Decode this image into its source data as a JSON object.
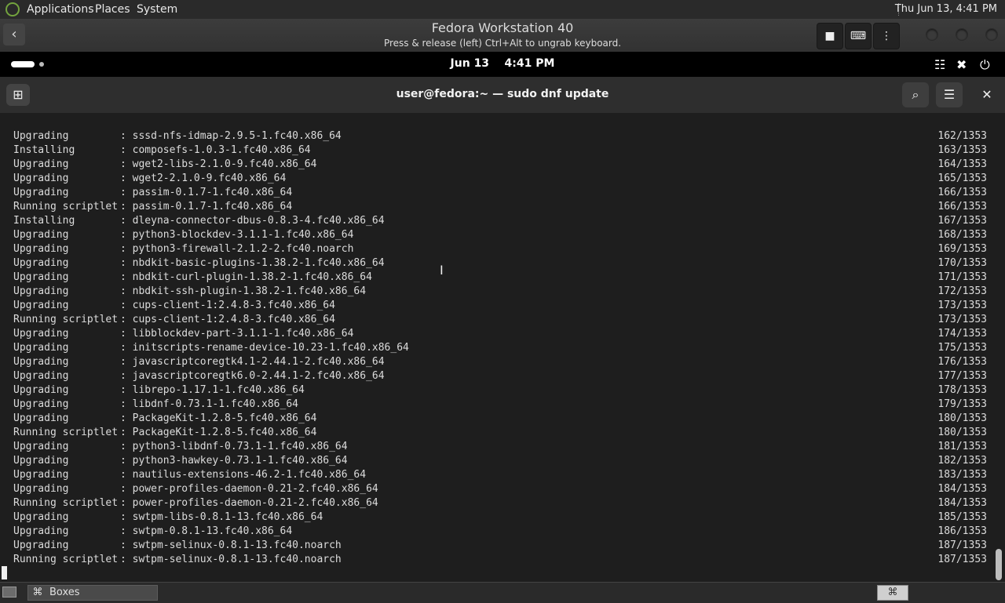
{
  "host_panel": {
    "menus": [
      "Applications",
      "Places",
      "System"
    ],
    "clock": "Thu Jun 13,  4:41 PM"
  },
  "boxes_header": {
    "title": "Fedora Workstation 40",
    "subtitle": "Press & release (left) Ctrl+Alt to ungrab keyboard.",
    "back_icon": "back-arrow-icon",
    "buttons": [
      "stop-icon",
      "keyboard-icon",
      "more-vertical-icon"
    ]
  },
  "guest_bar": {
    "date": "Jun 13",
    "time": "4:41 PM",
    "icons": [
      "network-icon",
      "volume-muted-icon",
      "power-icon"
    ]
  },
  "terminal": {
    "title": "user@fedora:~ — sudo dnf update",
    "lines": [
      {
        "action": "Upgrading",
        "package": "sssd-nfs-idmap-2.9.5-1.fc40.x86_64",
        "count": "162/1353"
      },
      {
        "action": "Installing",
        "package": "composefs-1.0.3-1.fc40.x86_64",
        "count": "163/1353"
      },
      {
        "action": "Upgrading",
        "package": "wget2-libs-2.1.0-9.fc40.x86_64",
        "count": "164/1353"
      },
      {
        "action": "Upgrading",
        "package": "wget2-2.1.0-9.fc40.x86_64",
        "count": "165/1353"
      },
      {
        "action": "Upgrading",
        "package": "passim-0.1.7-1.fc40.x86_64",
        "count": "166/1353"
      },
      {
        "action": "Running scriptlet",
        "package": "passim-0.1.7-1.fc40.x86_64",
        "count": "166/1353"
      },
      {
        "action": "Installing",
        "package": "dleyna-connector-dbus-0.8.3-4.fc40.x86_64",
        "count": "167/1353"
      },
      {
        "action": "Upgrading",
        "package": "python3-blockdev-3.1.1-1.fc40.x86_64",
        "count": "168/1353"
      },
      {
        "action": "Upgrading",
        "package": "python3-firewall-2.1.2-2.fc40.noarch",
        "count": "169/1353"
      },
      {
        "action": "Upgrading",
        "package": "nbdkit-basic-plugins-1.38.2-1.fc40.x86_64",
        "count": "170/1353"
      },
      {
        "action": "Upgrading",
        "package": "nbdkit-curl-plugin-1.38.2-1.fc40.x86_64",
        "count": "171/1353"
      },
      {
        "action": "Upgrading",
        "package": "nbdkit-ssh-plugin-1.38.2-1.fc40.x86_64",
        "count": "172/1353"
      },
      {
        "action": "Upgrading",
        "package": "cups-client-1:2.4.8-3.fc40.x86_64",
        "count": "173/1353"
      },
      {
        "action": "Running scriptlet",
        "package": "cups-client-1:2.4.8-3.fc40.x86_64",
        "count": "173/1353"
      },
      {
        "action": "Upgrading",
        "package": "libblockdev-part-3.1.1-1.fc40.x86_64",
        "count": "174/1353"
      },
      {
        "action": "Upgrading",
        "package": "initscripts-rename-device-10.23-1.fc40.x86_64",
        "count": "175/1353"
      },
      {
        "action": "Upgrading",
        "package": "javascriptcoregtk4.1-2.44.1-2.fc40.x86_64",
        "count": "176/1353"
      },
      {
        "action": "Upgrading",
        "package": "javascriptcoregtk6.0-2.44.1-2.fc40.x86_64",
        "count": "177/1353"
      },
      {
        "action": "Upgrading",
        "package": "librepo-1.17.1-1.fc40.x86_64",
        "count": "178/1353"
      },
      {
        "action": "Upgrading",
        "package": "libdnf-0.73.1-1.fc40.x86_64",
        "count": "179/1353"
      },
      {
        "action": "Upgrading",
        "package": "PackageKit-1.2.8-5.fc40.x86_64",
        "count": "180/1353"
      },
      {
        "action": "Running scriptlet",
        "package": "PackageKit-1.2.8-5.fc40.x86_64",
        "count": "180/1353"
      },
      {
        "action": "Upgrading",
        "package": "python3-libdnf-0.73.1-1.fc40.x86_64",
        "count": "181/1353"
      },
      {
        "action": "Upgrading",
        "package": "python3-hawkey-0.73.1-1.fc40.x86_64",
        "count": "182/1353"
      },
      {
        "action": "Upgrading",
        "package": "nautilus-extensions-46.2-1.fc40.x86_64",
        "count": "183/1353"
      },
      {
        "action": "Upgrading",
        "package": "power-profiles-daemon-0.21-2.fc40.x86_64",
        "count": "184/1353"
      },
      {
        "action": "Running scriptlet",
        "package": "power-profiles-daemon-0.21-2.fc40.x86_64",
        "count": "184/1353"
      },
      {
        "action": "Upgrading",
        "package": "swtpm-libs-0.8.1-13.fc40.x86_64",
        "count": "185/1353"
      },
      {
        "action": "Upgrading",
        "package": "swtpm-0.8.1-13.fc40.x86_64",
        "count": "186/1353"
      },
      {
        "action": "Upgrading",
        "package": "swtpm-selinux-0.8.1-13.fc40.noarch",
        "count": "187/1353"
      },
      {
        "action": "Running scriptlet",
        "package": "swtpm-selinux-0.8.1-13.fc40.noarch",
        "count": "187/1353"
      }
    ]
  },
  "taskbar": {
    "window_label": "Boxes"
  },
  "colors": {
    "terminal_bg": "#1e1e1e",
    "terminal_fg": "#dcdcdc",
    "header_bg": "#2e2e2e"
  }
}
